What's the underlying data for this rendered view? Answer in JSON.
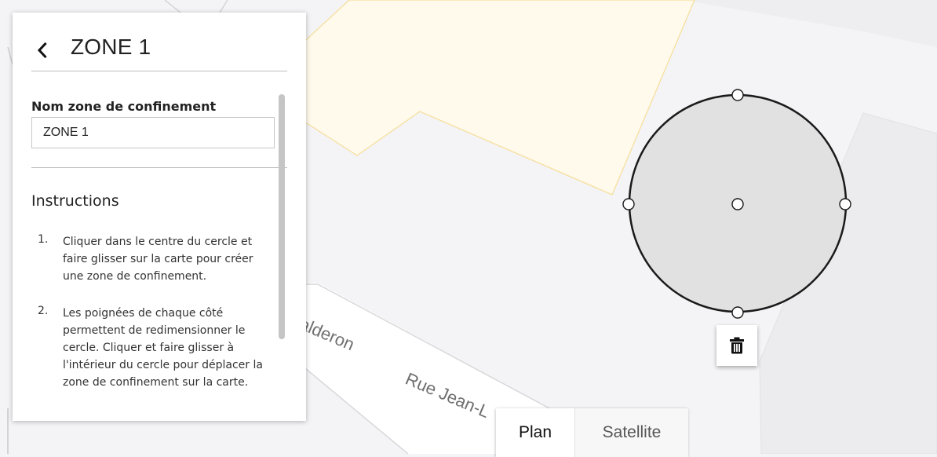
{
  "panel": {
    "title": "ZONE 1",
    "field_label": "Nom zone de confinement",
    "field_value": "ZONE 1",
    "instructions_heading": "Instructions",
    "steps": [
      {
        "num": "1.",
        "text": "Cliquer dans le centre du cercle et faire glisser sur la carte pour créer une zone de confinement."
      },
      {
        "num": "2.",
        "text": "Les poignées de chaque côté permettent de redimensionner le cercle. Cliquer et faire glisser à l'intérieur du cercle pour déplacer la zone de confinement sur la carte."
      }
    ]
  },
  "map": {
    "street_labels": [
      "alderon",
      "Rue Jean-L"
    ],
    "map_type": {
      "plan": "Plan",
      "satellite": "Satellite",
      "selected": "Plan"
    }
  },
  "icons": {
    "back": "chevron-left-icon",
    "delete": "trash-icon"
  },
  "colors": {
    "map_background": "#f4f4f6",
    "building_fill": "#fffaec",
    "building_outline": "#f6df9e",
    "zone_fill": "#e1e1e1",
    "zone_stroke": "#1a1a1a"
  }
}
